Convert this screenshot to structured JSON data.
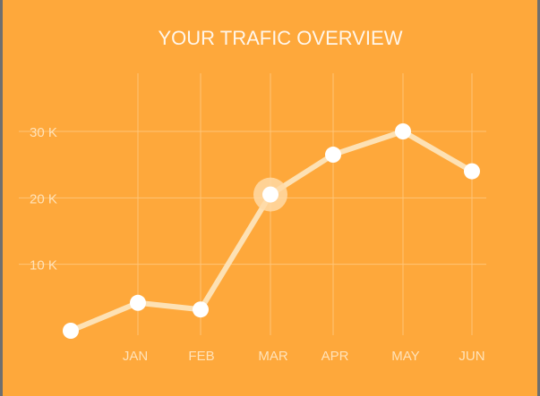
{
  "colors": {
    "background": "#fea83b",
    "line": "#fde1b4",
    "point": "#ffffff",
    "grid": "#ffc577",
    "tick_label": "#ffe2b8",
    "title": "#fff6ea",
    "highlight_halo": "#ffd9a6"
  },
  "chart_data": {
    "type": "line",
    "title": "YOUR TRAFIC OVERVIEW",
    "xlabel": "",
    "ylabel": "",
    "x": [
      "",
      "JAN",
      "FEB",
      "MAR",
      "APR",
      "MAY",
      "JUN"
    ],
    "y_ticks": [
      {
        "value": 10000,
        "label": "10 K"
      },
      {
        "value": 20000,
        "label": "20 K"
      },
      {
        "value": 30000,
        "label": "30 K"
      }
    ],
    "ylim": [
      0,
      30000
    ],
    "grid": true,
    "legend": "none",
    "series": [
      {
        "values": [
          0,
          4200,
          3200,
          20500,
          26500,
          30000,
          24000
        ]
      }
    ],
    "highlighted_index": 3
  }
}
